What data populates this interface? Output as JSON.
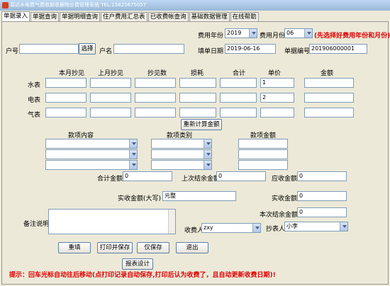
{
  "window": {
    "title": "易达水电费气费收款收据物业费管理系统 TEL:15825675057"
  },
  "tabs": [
    {
      "label": "单据录入",
      "active": true
    },
    {
      "label": "单据查询",
      "active": false
    },
    {
      "label": "单据明细查询",
      "active": false
    },
    {
      "label": "住户费用汇总表",
      "active": false
    },
    {
      "label": "已收费帐查询",
      "active": false
    },
    {
      "label": "基础数据管理",
      "active": false
    },
    {
      "label": "在线帮助",
      "active": false
    }
  ],
  "fee_period": {
    "year_label": "费用年份",
    "year_value": "2019",
    "month_label": "费用月份",
    "month_value": "06",
    "note": "(先选择好费用年份和月份)"
  },
  "header_fields": {
    "account_label": "户号",
    "account_value": "",
    "select_button": "选择",
    "name_label": "户名",
    "name_value": "",
    "date_label": "填单日期",
    "date_value": "2019-06-16",
    "number_label": "单据编号",
    "number_value": "201906000001"
  },
  "meter_table": {
    "columns": [
      "本月抄见",
      "上月抄见",
      "抄见数",
      "损耗",
      "合计",
      "单价",
      "金额"
    ],
    "rows": [
      {
        "label": "水表",
        "unit_price": "1"
      },
      {
        "label": "电表",
        "unit_price": "2"
      },
      {
        "label": "气表",
        "unit_price": ""
      }
    ],
    "recalc_button": "重新计算金额"
  },
  "items": {
    "content_header": "款项内容",
    "type_header": "款项类别",
    "amount_header": "款项金额"
  },
  "totals": {
    "total_label": "合计金额",
    "total_value": "0",
    "prev_balance_label": "上次结余金额",
    "prev_balance_value": "0",
    "receivable_label": "应收金额",
    "receivable_value": "0",
    "actual_upper_label": "实收金额(大写)",
    "actual_upper_value": "元整",
    "actual_label": "实收金额",
    "actual_value": "0",
    "this_balance_label": "本次结余金额",
    "this_balance_value": "0"
  },
  "remarks": {
    "label": "备注说明",
    "payee_label": "收费人",
    "payee_value": "zxy",
    "reader_label": "抄表人",
    "reader_value": "小李"
  },
  "actions": {
    "refill": "重填",
    "print_save": "打印并保存",
    "save_only": "仅保存",
    "exit": "退出",
    "report_design": "报表设计"
  },
  "hint": "提示：回车光标自动往后移动(点打印记录自动保存,打印后认为收费了，且自动更新收费日期)!"
}
